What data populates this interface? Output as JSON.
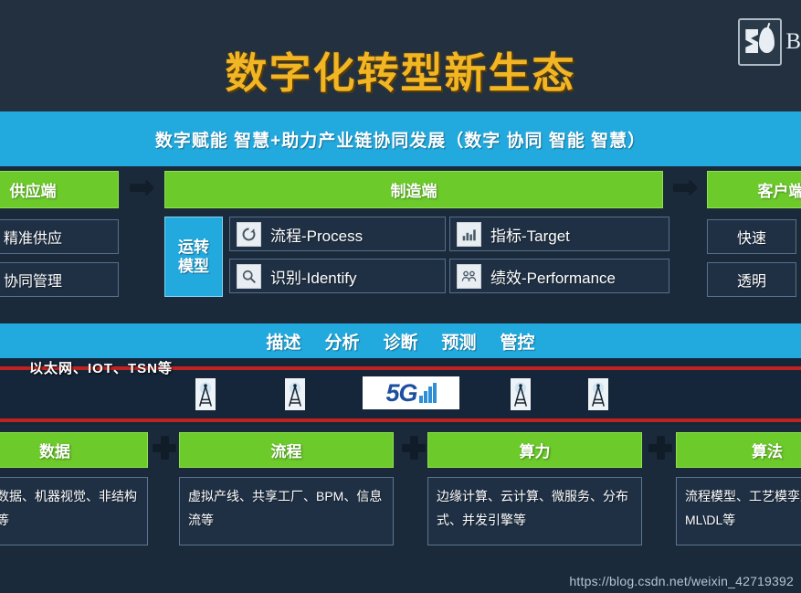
{
  "slide": {
    "title": "数字化转型新生态",
    "brand": {
      "name": "B",
      "mark": "brand-square-icon"
    },
    "slogan": "数字赋能 智慧+助力产业链协同发展（数字 协同 智能 智慧）"
  },
  "value_chain": {
    "supply": {
      "head": "供应端",
      "chips": [
        "精准供应",
        "协同管理"
      ]
    },
    "arrow_1": "➡",
    "manufacture": {
      "head": "制造端",
      "model_box": "运转\n模型",
      "features": [
        {
          "label": "流程-Process",
          "icon": "refresh-cycle-icon"
        },
        {
          "label": "识别-Identify",
          "icon": "magnifier-icon"
        },
        {
          "label": "指标-Target",
          "icon": "bar-chart-icon"
        },
        {
          "label": "绩效-Performance",
          "icon": "people-group-icon"
        }
      ]
    },
    "arrow_2": "➡",
    "client": {
      "head": "客户端",
      "chips": [
        "快速",
        "透明"
      ]
    }
  },
  "analytics": {
    "items": [
      "描述",
      "分析",
      "诊断",
      "预测",
      "管控"
    ]
  },
  "network": {
    "label": "以太网、IOT、TSN等",
    "badge_5g": "5G",
    "tower_icon": "cell-tower-icon",
    "tower_count": 4
  },
  "foundation": {
    "separator": "+",
    "pillars": [
      {
        "head": "数据",
        "body": "、流数据、机器视觉、非结构数据等"
      },
      {
        "head": "流程",
        "body": "虚拟产线、共享工厂、BPM、信息流等"
      },
      {
        "head": "算力",
        "body": "边缘计算、云计算、微服务、分布式、并发引擎等"
      },
      {
        "head": "算法",
        "body": "流程模型、工艺模孪生、ML\\DL等"
      }
    ]
  },
  "watermark": "https://blog.csdn.net/weixin_42719392",
  "colors": {
    "title_gold": "#f2b524",
    "accent_blue": "#22a9de",
    "accent_green": "#6ccb2b",
    "background_dark": "#1b2a3b",
    "title_band": "#22303f",
    "rule_red": "#c0231f"
  }
}
